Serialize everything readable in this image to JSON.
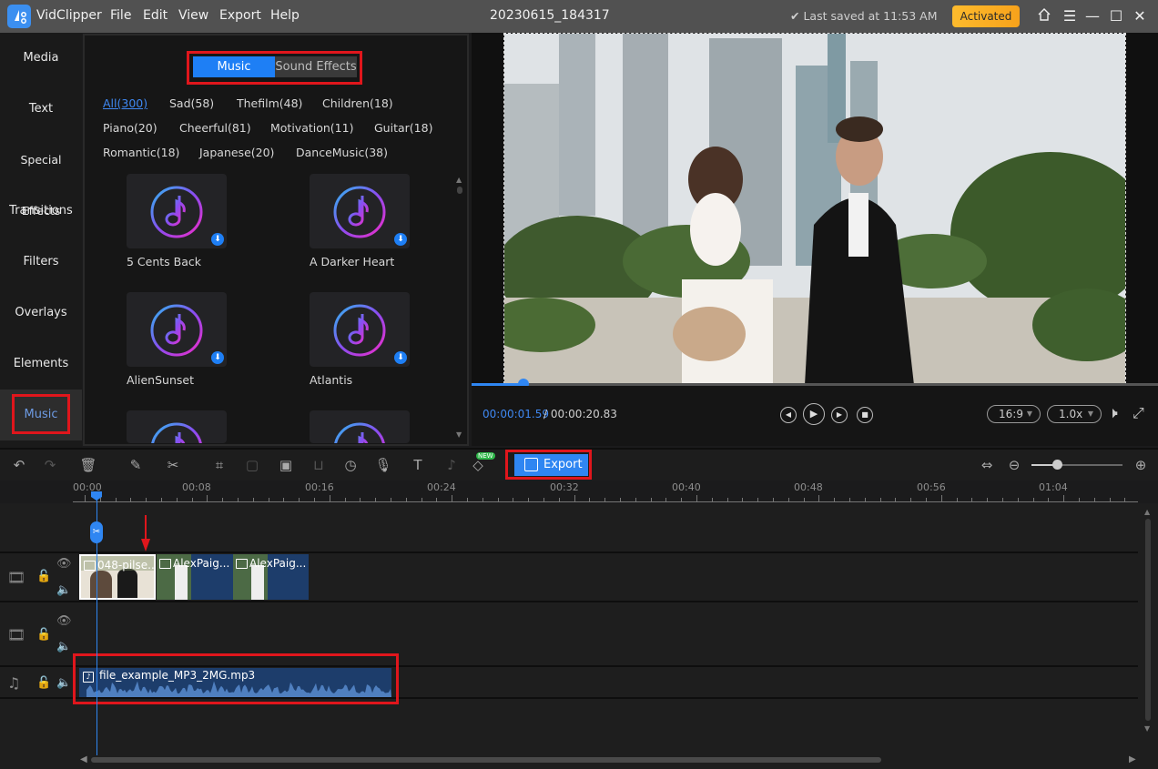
{
  "titlebar": {
    "app_name": "VidClipper",
    "menu": [
      "File",
      "Edit",
      "View",
      "Export",
      "Help"
    ],
    "project_title": "20230615_184317",
    "save_status": "✔ Last saved at 11:53 AM",
    "activated_label": "Activated",
    "icons": [
      "home-icon",
      "hamburger-menu-icon",
      "minimize-icon",
      "maximize-icon",
      "close-icon"
    ]
  },
  "sidebar": {
    "items": [
      {
        "label": "Media"
      },
      {
        "label": "Text"
      },
      {
        "label": "Special Effects"
      },
      {
        "label": "Transitions"
      },
      {
        "label": "Filters"
      },
      {
        "label": "Overlays"
      },
      {
        "label": "Elements"
      },
      {
        "label": "Music",
        "active": true
      }
    ]
  },
  "library": {
    "tabs": [
      {
        "label": "Music",
        "active": true
      },
      {
        "label": "Sound Effects"
      }
    ],
    "categories": [
      {
        "label": "All(300)",
        "active": true
      },
      {
        "label": "Sad(58)"
      },
      {
        "label": "Thefilm(48)"
      },
      {
        "label": "Children(18)"
      },
      {
        "label": "Piano(20)"
      },
      {
        "label": "Cheerful(81)"
      },
      {
        "label": "Motivation(11)"
      },
      {
        "label": "Guitar(18)"
      },
      {
        "label": "Romantic(18)"
      },
      {
        "label": "Japanese(20)"
      },
      {
        "label": "DanceMusic(38)"
      }
    ],
    "tracks": [
      {
        "title": "5 Cents Back"
      },
      {
        "title": "A Darker Heart"
      },
      {
        "title": "AlienSunset"
      },
      {
        "title": "Atlantis"
      },
      {
        "title": ""
      },
      {
        "title": ""
      }
    ]
  },
  "preview": {
    "current_time": "00:00:01.59",
    "total_time": "/ 00:00:20.83",
    "progress_fraction": 0.076,
    "aspect_ratio": "16:9",
    "speed": "1.0x"
  },
  "timeline_toolbar": {
    "export_label": "Export",
    "new_badge": "NEW",
    "zoom_level_fraction": 0.28
  },
  "ruler": {
    "ticks": [
      "00:00",
      "00:08",
      "00:16",
      "00:24",
      "00:32",
      "00:40",
      "00:48",
      "00:56",
      "01:04"
    ]
  },
  "tracks": {
    "video_clips": [
      {
        "name": "048-pilse..."
      },
      {
        "name": "AlexPaig..."
      },
      {
        "name": "AlexPaig..."
      }
    ],
    "audio_clip": {
      "name": "file_example_MP3_2MG.mp3"
    }
  },
  "colors": {
    "accent": "#2f86f2",
    "highlight": "#e0161c",
    "activated": "#fdbb2d"
  }
}
